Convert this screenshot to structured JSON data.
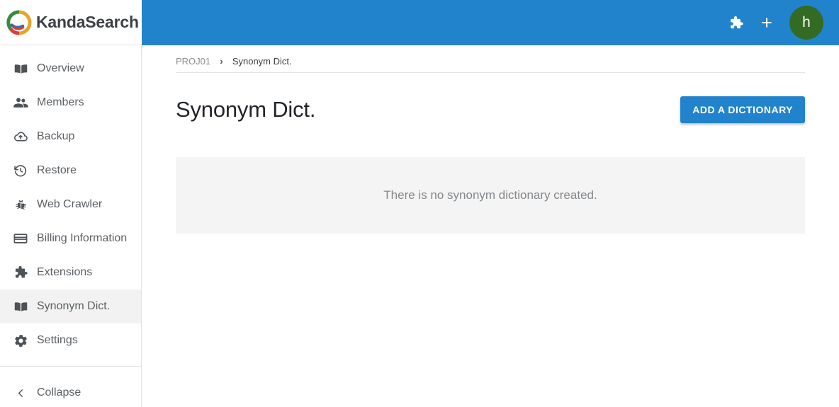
{
  "brand": {
    "name": "KandaSearch",
    "logo_icon": "kandasearch-ring-logo",
    "colors": {
      "green": "#3a8a3d",
      "orange": "#e8a427",
      "red": "#d6403a",
      "blue": "#2b6fb5"
    }
  },
  "topbar": {
    "background": "#2283cd",
    "extensions_icon": "puzzle-piece-icon",
    "add_icon": "plus-icon",
    "add_label": "+",
    "avatar": {
      "initial": "h",
      "color": "#336b24"
    }
  },
  "sidebar": {
    "items": [
      {
        "label": "Overview",
        "icon": "book-icon",
        "active": false
      },
      {
        "label": "Members",
        "icon": "people-icon",
        "active": false
      },
      {
        "label": "Backup",
        "icon": "cloud-upload-icon",
        "active": false
      },
      {
        "label": "Restore",
        "icon": "history-icon",
        "active": false
      },
      {
        "label": "Web Crawler",
        "icon": "bug-icon",
        "active": false
      },
      {
        "label": "Billing Information",
        "icon": "credit-card-icon",
        "active": false
      },
      {
        "label": "Extensions",
        "icon": "puzzle-piece-icon",
        "active": false
      },
      {
        "label": "Synonym Dict.",
        "icon": "book-icon",
        "active": true
      },
      {
        "label": "Settings",
        "icon": "gear-icon",
        "active": false
      }
    ],
    "collapse": {
      "label": "Collapse",
      "icon": "chevron-left-icon"
    }
  },
  "main": {
    "breadcrumb": {
      "project": "PROJ01",
      "separator": "›",
      "current": "Synonym Dict."
    },
    "page_title": "Synonym Dict.",
    "add_button_label": "ADD A DICTIONARY",
    "empty_state_message": "There is no synonym dictionary created."
  }
}
